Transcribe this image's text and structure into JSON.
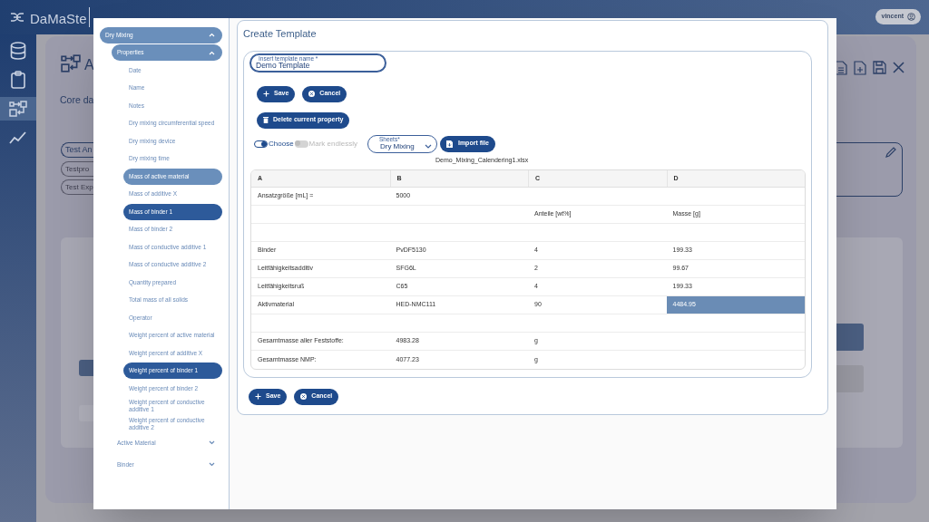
{
  "app": {
    "logo": "DaMaSte",
    "user": "vincent",
    "nav": [
      {
        "selected": false
      },
      {
        "selected": false
      },
      {
        "selected": true
      },
      {
        "selected": false
      }
    ],
    "heading": "A",
    "section": "Core da",
    "chips": [
      {
        "label": "Test An",
        "kind": "strong"
      },
      {
        "label": "Testpro",
        "kind": "faint"
      },
      {
        "label": "Test Exp",
        "kind": "faint"
      }
    ]
  },
  "tree": [
    {
      "kind": "group",
      "label": "Dry Mixing",
      "expanded": true,
      "children": [
        {
          "kind": "group",
          "label": "Properties",
          "expanded": true,
          "children": [
            {
              "kind": "leaf",
              "label": "Date",
              "selected": false,
              "highlighted": false
            },
            {
              "kind": "leaf",
              "label": "Name",
              "selected": false,
              "highlighted": false
            },
            {
              "kind": "leaf",
              "label": "Notes",
              "selected": false,
              "highlighted": false
            },
            {
              "kind": "leaf",
              "label": "Dry mixing circumferential speed",
              "selected": false,
              "highlighted": false
            },
            {
              "kind": "leaf",
              "label": "Dry mixing device",
              "selected": false,
              "highlighted": false
            },
            {
              "kind": "leaf",
              "label": "Dry mixing time",
              "selected": false,
              "highlighted": false
            },
            {
              "kind": "leaf",
              "label": "Mass of active material",
              "selected": false,
              "highlighted": true
            },
            {
              "kind": "leaf",
              "label": "Mass of additive X",
              "selected": false,
              "highlighted": false
            },
            {
              "kind": "leaf",
              "label": "Mass of binder 1",
              "selected": true,
              "highlighted": false
            },
            {
              "kind": "leaf",
              "label": "Mass of binder 2",
              "selected": false,
              "highlighted": false
            },
            {
              "kind": "leaf",
              "label": "Mass of conductive additive 1",
              "selected": false,
              "highlighted": false
            },
            {
              "kind": "leaf",
              "label": "Mass of conductive additive 2",
              "selected": false,
              "highlighted": false
            },
            {
              "kind": "leaf",
              "label": "Quantity prepared",
              "selected": false,
              "highlighted": false
            },
            {
              "kind": "leaf",
              "label": "Total mass of all solids",
              "selected": false,
              "highlighted": false
            },
            {
              "kind": "leaf",
              "label": "Operator",
              "selected": false,
              "highlighted": false
            },
            {
              "kind": "leaf",
              "label": "Weight percent of active material",
              "selected": false,
              "highlighted": false
            },
            {
              "kind": "leaf",
              "label": "Weight percent of additive X",
              "selected": false,
              "highlighted": false
            },
            {
              "kind": "leaf",
              "label": "Weight percent of binder 1",
              "selected": true,
              "highlighted": false
            },
            {
              "kind": "leaf",
              "label": "Weight percent of binder 2",
              "selected": false,
              "highlighted": false
            },
            {
              "kind": "leaf",
              "label": "Weight percent of conductive additive 1",
              "selected": false,
              "highlighted": false
            },
            {
              "kind": "leaf",
              "label": "Weight percent of conductive additive 2",
              "selected": false,
              "highlighted": false
            }
          ]
        },
        {
          "kind": "group",
          "label": "Active Material",
          "expanded": false
        },
        {
          "kind": "group",
          "label": "Binder",
          "expanded": false
        }
      ]
    }
  ],
  "dialog": {
    "title": "Create Template",
    "name_field": {
      "label": "Insert template name *",
      "value": "Demo Template"
    },
    "buttons": [
      {
        "label": "Save",
        "kind": "save"
      },
      {
        "label": "Cancel",
        "kind": "cancel"
      }
    ],
    "delete_button": "Delete current property",
    "toggles": [
      {
        "label": "Choose",
        "on": true
      },
      {
        "label": "Mark endlessly",
        "on": false
      }
    ],
    "sheet_select": {
      "label": "Sheets*",
      "value": "Dry Mixing"
    },
    "import_button": "Import file",
    "file_name": "Demo_Mixing_Calendering1.xlsx",
    "table": {
      "columns": [
        "A",
        "B",
        "C",
        "D"
      ],
      "rows": [
        [
          {
            "text": "Ansatzgröße [mL] =",
            "selected": false
          },
          {
            "text": "5000",
            "selected": false
          },
          null,
          null
        ],
        [
          null,
          null,
          {
            "text": "Anteile [wt%]",
            "selected": false
          },
          {
            "text": "Masse [g]",
            "selected": false
          }
        ],
        [
          null,
          null,
          null,
          null
        ],
        [
          {
            "text": "Binder",
            "selected": false
          },
          {
            "text": "PvDF5130",
            "selected": false
          },
          {
            "text": "4",
            "selected": false
          },
          {
            "text": "199.33",
            "selected": false
          }
        ],
        [
          {
            "text": "Leitfähigkeitsadditiv",
            "selected": false
          },
          {
            "text": "SFG6L",
            "selected": false
          },
          {
            "text": "2",
            "selected": false
          },
          {
            "text": "99.67",
            "selected": false
          }
        ],
        [
          {
            "text": "Leitfähigkeitsruß",
            "selected": false
          },
          {
            "text": "C65",
            "selected": false
          },
          {
            "text": "4",
            "selected": false
          },
          {
            "text": "199.33",
            "selected": false
          }
        ],
        [
          {
            "text": "Aktivmaterial",
            "selected": false
          },
          {
            "text": "HED-NMC111",
            "selected": false
          },
          {
            "text": "90",
            "selected": false
          },
          {
            "text": "4484.95",
            "selected": true
          }
        ],
        [
          null,
          null,
          null,
          null
        ],
        [
          {
            "text": "Gesamtmasse aller Feststoffe:",
            "selected": false
          },
          {
            "text": "4983.28",
            "selected": false
          },
          {
            "text": "g",
            "selected": false
          },
          null
        ],
        [
          {
            "text": "Gesamtmasse NMP:",
            "selected": false
          },
          {
            "text": "4077.23",
            "selected": false
          },
          {
            "text": "g",
            "selected": false
          },
          null
        ]
      ]
    },
    "footer_buttons": [
      {
        "label": "Save",
        "kind": "save"
      },
      {
        "label": "Cancel",
        "kind": "cancel"
      }
    ]
  }
}
